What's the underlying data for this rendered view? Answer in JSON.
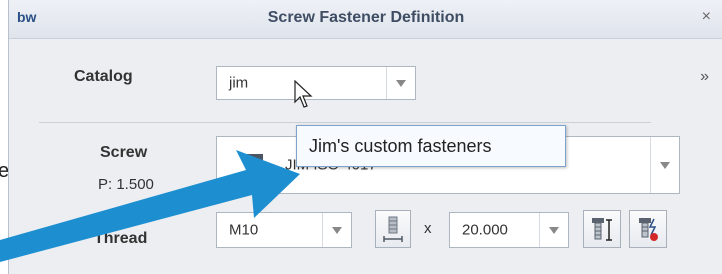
{
  "window": {
    "logo_text": "bw",
    "title": "Screw Fastener Definition",
    "close_glyph": "×",
    "expand_glyph": "»"
  },
  "catalog": {
    "label": "Catalog",
    "value": "jim",
    "tooltip": "Jim's custom fasteners"
  },
  "screw": {
    "label": "Screw",
    "sublabel": "P: 1.500",
    "value": "JIM ISO 4017"
  },
  "thread": {
    "label": "Thread",
    "size_value": "M10",
    "times": "x",
    "length_value": "20.000"
  },
  "colors": {
    "accent_arrow": "#1d8fd0",
    "tooltip_border": "#7ea2ca"
  },
  "icons": {
    "dropdown": "chevron-down-icon",
    "screw_visual": "screw-icon",
    "thread_measure": "thread-length-icon",
    "screw_dimension": "screw-dimension-icon",
    "screw_placement": "screw-placement-icon",
    "cursor": "pointer-cursor",
    "callout": "callout-arrow"
  }
}
